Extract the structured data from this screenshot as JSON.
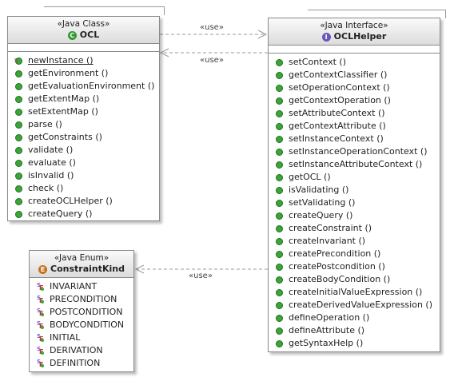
{
  "connector_label": "«use»",
  "ocl": {
    "stereotype": "«Java Class»",
    "name": "OCL",
    "icon_letter": "C",
    "static_method": "newInstance ()",
    "methods": [
      "getEnvironment ()",
      "getEvaluationEnvironment ()",
      "getExtentMap ()",
      "setExtentMap ()",
      "parse ()",
      "getConstraints ()",
      "validate ()",
      "evaluate ()",
      "isInvalid ()",
      "check ()",
      "createOCLHelper ()",
      "createQuery ()"
    ]
  },
  "helper": {
    "stereotype": "«Java Interface»",
    "name": "OCLHelper",
    "icon_letter": "I",
    "methods": [
      "setContext ()",
      "getContextClassifier ()",
      "setOperationContext ()",
      "getContextOperation ()",
      "setAttributeContext ()",
      "getContextAttribute ()",
      "setInstanceContext ()",
      "setInstanceOperationContext ()",
      "setInstanceAttributeContext ()",
      "getOCL ()",
      "isValidating ()",
      "setValidating ()",
      "createQuery ()",
      "createConstraint ()",
      "createInvariant ()",
      "createPrecondition ()",
      "createPostcondition ()",
      "createBodyCondition ()",
      "createInitialValueExpression ()",
      "createDerivedValueExpression ()",
      "defineOperation ()",
      "defineAttribute ()",
      "getSyntaxHelp ()"
    ]
  },
  "kind": {
    "stereotype": "«Java Enum»",
    "name": "ConstraintKind",
    "icon_letter": "E",
    "literals": [
      "INVARIANT",
      "PRECONDITION",
      "POSTCONDITION",
      "BODYCONDITION",
      "INITIAL",
      "DERIVATION",
      "DEFINITION"
    ]
  }
}
